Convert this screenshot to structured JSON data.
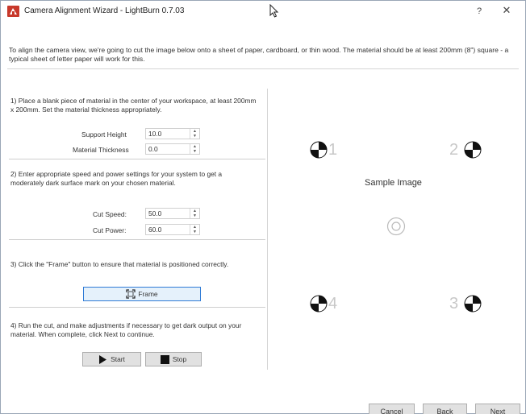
{
  "window": {
    "title": "Camera Alignment Wizard - LightBurn 0.7.03",
    "help_label": "?",
    "close_label": "✕"
  },
  "intro_text": "To align the camera view, we're going to cut the image below onto a sheet of paper, cardboard, or thin wood.  The material should be at least 200mm (8\") square - a typical sheet of letter paper will work for this.",
  "step1": {
    "text": "1) Place a blank piece of material in the center of your workspace, at least 200mm x 200mm. Set the material thickness appropriately.",
    "support_height_label": "Support Height",
    "support_height_value": "10.0",
    "material_thickness_label": "Material Thickness",
    "material_thickness_value": "0.0"
  },
  "step2": {
    "text": "2) Enter appropriate speed and power settings for your system to get a moderately dark surface mark on your chosen material.",
    "cut_speed_label": "Cut Speed:",
    "cut_speed_value": "50.0",
    "cut_power_label": "Cut Power:",
    "cut_power_value": "60.0"
  },
  "step3": {
    "text": "3) Click the \"Frame\" button to ensure that material is positioned correctly.",
    "frame_label": "Frame"
  },
  "step4": {
    "text": "4) Run the cut, and make adjustments if necessary to get dark output on your material.  When complete, click Next to continue.",
    "start_label": "Start",
    "stop_label": "Stop"
  },
  "sample": {
    "label": "Sample Image",
    "markers": [
      "1",
      "2",
      "3",
      "4"
    ]
  },
  "footer": {
    "cancel_label": "Cancel",
    "back_label": "Back",
    "next_label": "Next"
  },
  "colors": {
    "accent": "#2f7bd6",
    "app_icon": "#c8392b",
    "marker_number": "#c8c8c8"
  }
}
